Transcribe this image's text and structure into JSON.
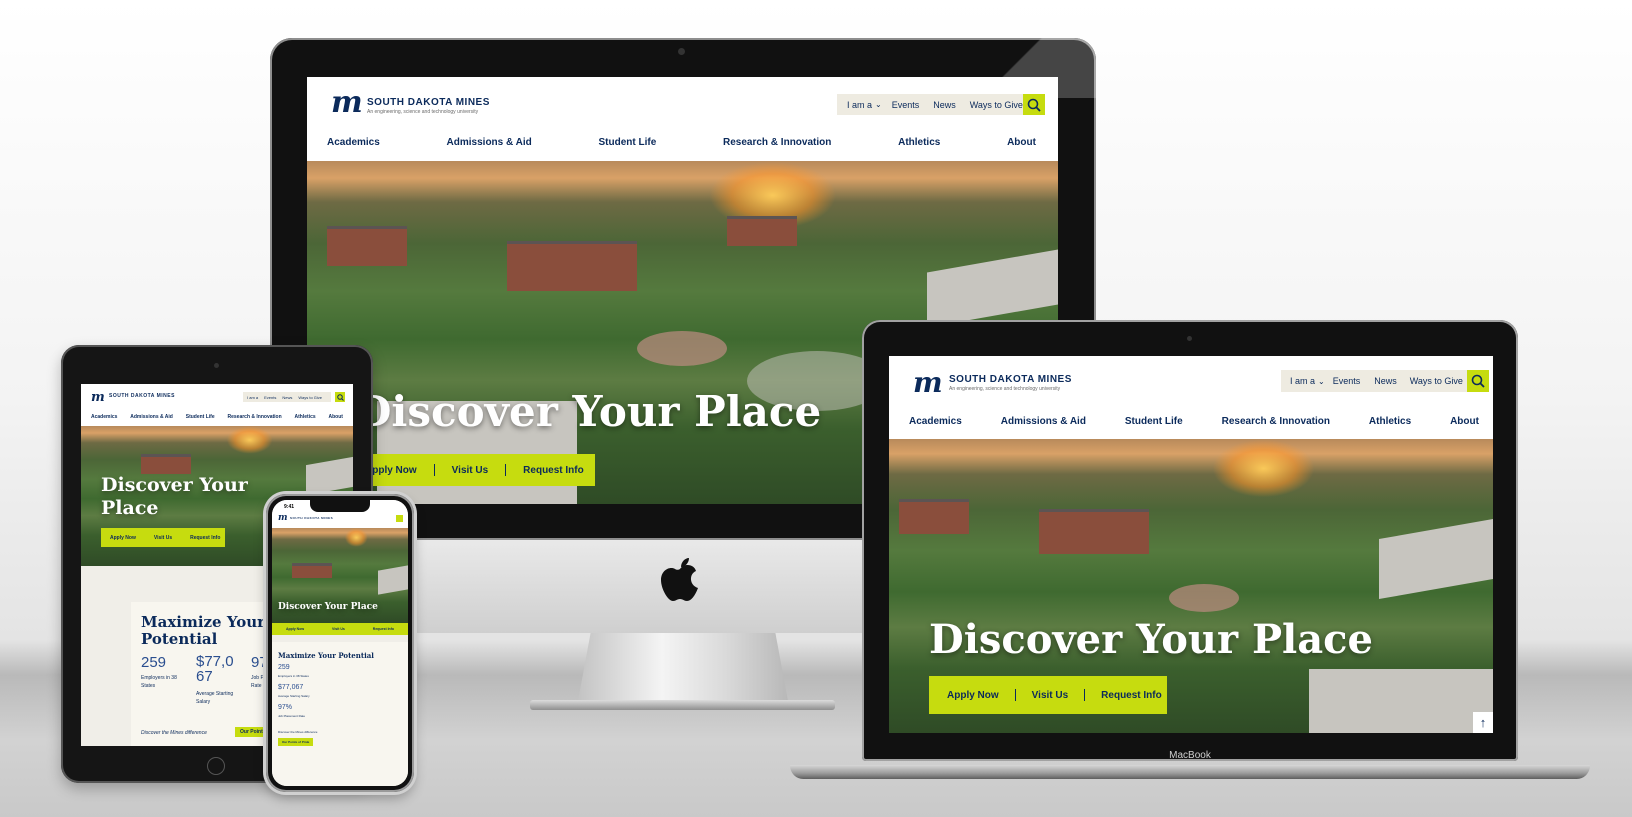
{
  "site": {
    "brand": "SOUTH DAKOTA MINES",
    "tagline": "An engineering, science and technology university",
    "logo_letter": "m",
    "util": {
      "iam": "I am a",
      "events": "Events",
      "news": "News",
      "give": "Ways to Give"
    },
    "nav": [
      "Academics",
      "Admissions & Aid",
      "Student Life",
      "Research & Innovation",
      "Athletics",
      "About"
    ],
    "hero_title": "Discover Your Place",
    "cta": [
      "Apply Now",
      "Visit Us",
      "Request Info"
    ],
    "stats": {
      "title": "Maximize Your Potential",
      "items": [
        {
          "value": "259",
          "label": "Employers in 38 States"
        },
        {
          "value": "$77,067",
          "label": "Average Starting Salary"
        },
        {
          "value": "97%",
          "label": "Job Placement Rate"
        }
      ],
      "difference": "Discover the Mines difference",
      "pride_button": "Our Points of Pride"
    }
  },
  "macbook_label": "MacBook",
  "phone_time": "9:41",
  "colors": {
    "navy": "#0b2a5b",
    "lime": "#c6dc0f",
    "cream": "#eeebe1"
  }
}
